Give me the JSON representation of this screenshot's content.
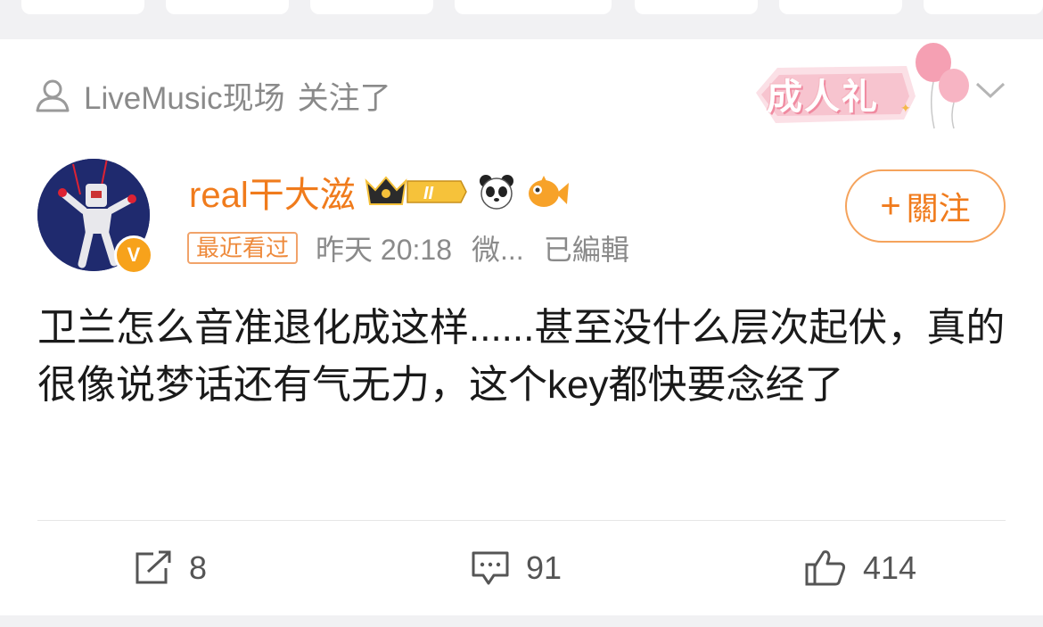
{
  "post": {
    "follow_source": {
      "name": "LiveMusic现场",
      "action": "关注了"
    },
    "event_badge": "成人礼",
    "author": {
      "name": "real干大滋",
      "level": "II",
      "verified_mark": "V"
    },
    "meta": {
      "recent_tag": "最近看过",
      "time": "昨天 20:18",
      "source": "微...",
      "edited": "已編輯"
    },
    "follow_button": {
      "plus": "+",
      "label": "關注"
    },
    "content": "卫兰怎么音准退化成这样......甚至没什么层次起伏，真的很像说梦话还有气无力，这个key都快要念经了",
    "actions": {
      "reposts": "8",
      "comments": "91",
      "likes": "414"
    },
    "icons": [
      "person-outline-icon",
      "chevron-down-icon",
      "crown-icon",
      "panda-icon",
      "fish-icon",
      "repost-icon",
      "comment-icon",
      "thumb-up-icon"
    ],
    "colors": {
      "accent": "#f07b1c",
      "muted": "#8a8a8a",
      "badge_pink": "#f08aa0"
    }
  }
}
